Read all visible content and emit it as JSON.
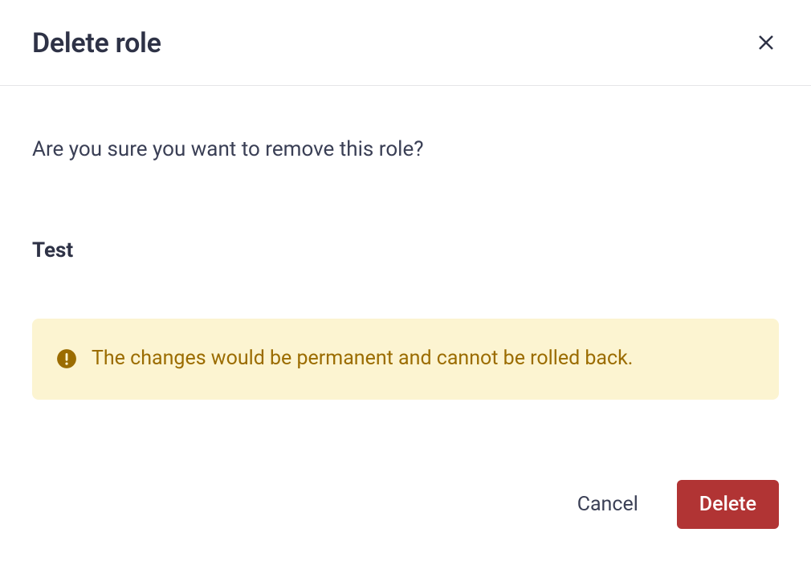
{
  "dialog": {
    "title": "Delete role",
    "confirm_text": "Are you sure you want to remove this role?",
    "role_name": "Test",
    "warning": {
      "text": "The changes would be permanent and cannot be rolled back."
    },
    "buttons": {
      "cancel": "Cancel",
      "delete": "Delete"
    }
  }
}
